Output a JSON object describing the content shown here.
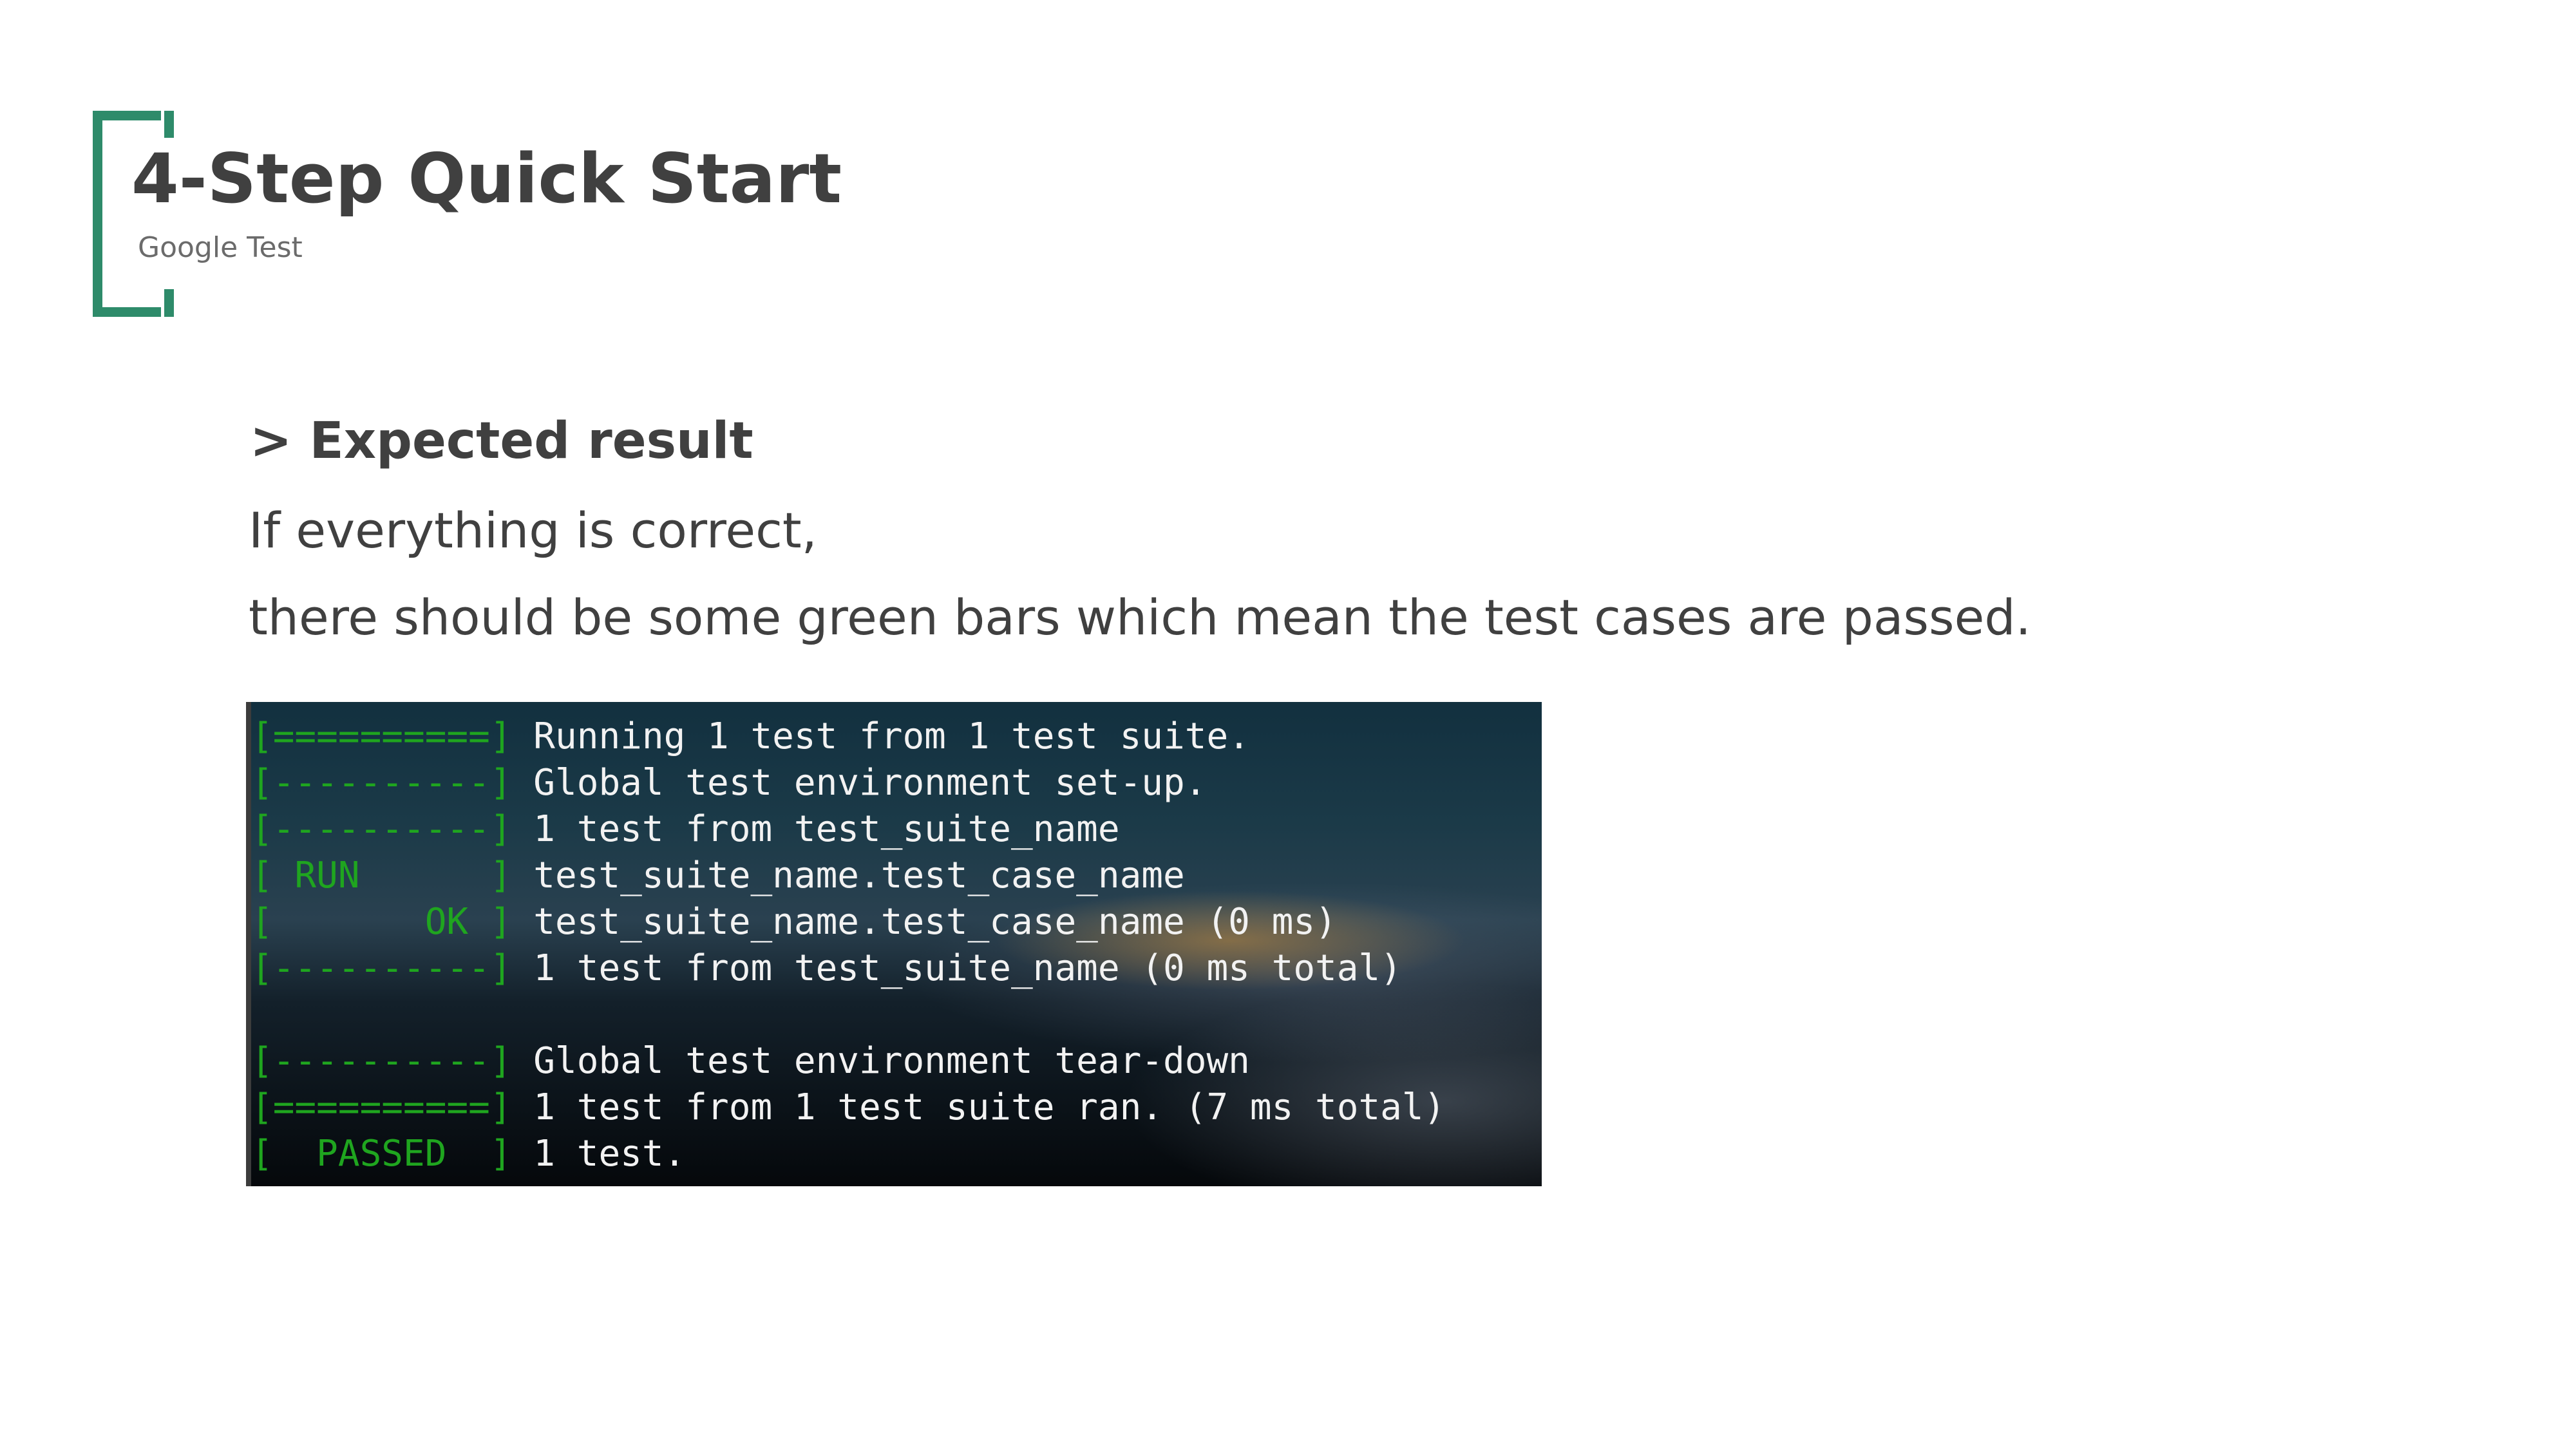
{
  "slide": {
    "title": "4-Step Quick Start",
    "subtitle": "Google Test",
    "section_heading": "> Expected result",
    "body_lines": [
      "If everything is correct,",
      "there should be some green bars which mean the test cases are passed."
    ]
  },
  "terminal": {
    "lines": [
      {
        "tag": "[==========]",
        "text": " Running 1 test from 1 test suite."
      },
      {
        "tag": "[----------]",
        "text": " Global test environment set-up."
      },
      {
        "tag": "[----------]",
        "text": " 1 test from test_suite_name"
      },
      {
        "tag": "[ RUN      ]",
        "text": " test_suite_name.test_case_name"
      },
      {
        "tag": "[       OK ]",
        "text": " test_suite_name.test_case_name (0 ms)"
      },
      {
        "tag": "[----------]",
        "text": " 1 test from test_suite_name (0 ms total)"
      },
      {
        "tag": "",
        "text": ""
      },
      {
        "tag": "[----------]",
        "text": " Global test environment tear-down"
      },
      {
        "tag": "[==========]",
        "text": " 1 test from 1 test suite ran. (7 ms total)"
      },
      {
        "tag": "[  PASSED  ]",
        "text": " 1 test."
      }
    ]
  },
  "colors": {
    "accent": "#2e8b6a",
    "terminal_tag": "#1fa51f",
    "text": "#404040"
  }
}
